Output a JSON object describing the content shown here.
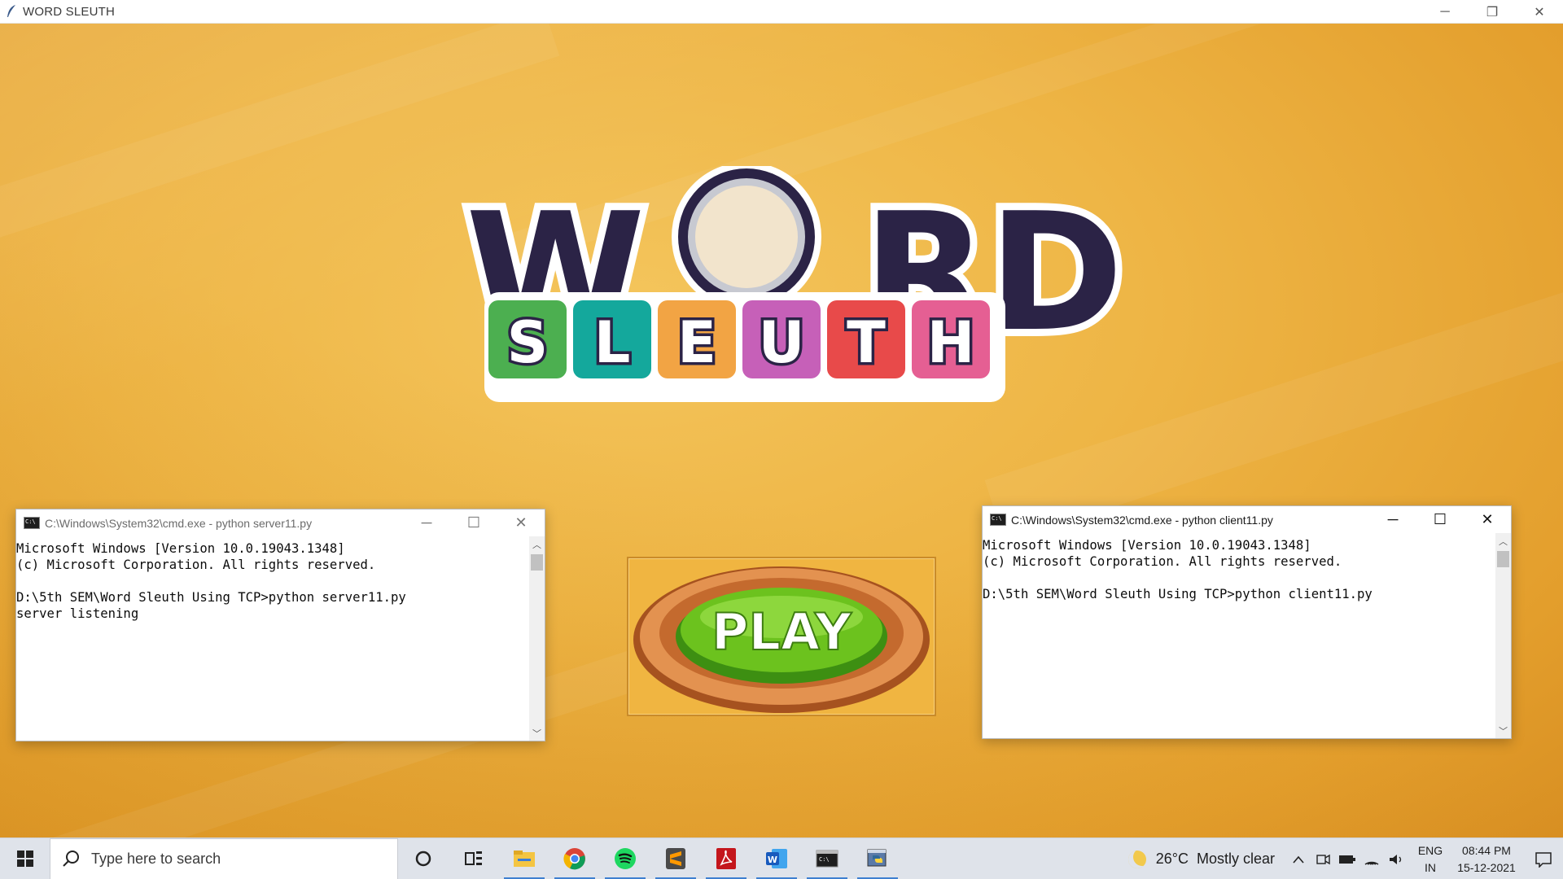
{
  "window": {
    "title": "WORD SLEUTH",
    "controls": {
      "minimize": "─",
      "restore": "❐",
      "close": "✕"
    }
  },
  "logo": {
    "word_left": "W",
    "word_right": "RD",
    "tiles": [
      {
        "letter": "S",
        "color": "#4caf50"
      },
      {
        "letter": "L",
        "color": "#14a89c"
      },
      {
        "letter": "E",
        "color": "#f2a444"
      },
      {
        "letter": "U",
        "color": "#c660b8"
      },
      {
        "letter": "T",
        "color": "#e84a4a"
      },
      {
        "letter": "H",
        "color": "#e55f93"
      }
    ],
    "dark_color": "#2b2346"
  },
  "play_button": {
    "label": "PLAY"
  },
  "server_console": {
    "title": "C:\\Windows\\System32\\cmd.exe - python  server11.py",
    "lines": "Microsoft Windows [Version 10.0.19043.1348]\n(c) Microsoft Corporation. All rights reserved.\n\nD:\\5th SEM\\Word Sleuth Using TCP>python server11.py\nserver listening"
  },
  "client_console": {
    "title": "C:\\Windows\\System32\\cmd.exe - python  client11.py",
    "lines": "Microsoft Windows [Version 10.0.19043.1348]\n(c) Microsoft Corporation. All rights reserved.\n\nD:\\5th SEM\\Word Sleuth Using TCP>python client11.py"
  },
  "taskbar": {
    "search_placeholder": "Type here to search",
    "apps": [
      {
        "name": "cortana-icon",
        "running": false
      },
      {
        "name": "task-view-icon",
        "running": false
      },
      {
        "name": "file-explorer-icon",
        "running": true
      },
      {
        "name": "chrome-icon",
        "running": true
      },
      {
        "name": "spotify-icon",
        "running": true
      },
      {
        "name": "sublime-text-icon",
        "running": true
      },
      {
        "name": "acrobat-icon",
        "running": true
      },
      {
        "name": "word-icon",
        "running": true
      },
      {
        "name": "cmd-icon",
        "running": true
      },
      {
        "name": "python-icon",
        "running": true
      }
    ],
    "weather": {
      "temp": "26°C",
      "condition": "Mostly clear"
    },
    "lang": {
      "line1": "ENG",
      "line2": "IN"
    },
    "clock": {
      "time": "08:44 PM",
      "date": "15-12-2021"
    }
  }
}
